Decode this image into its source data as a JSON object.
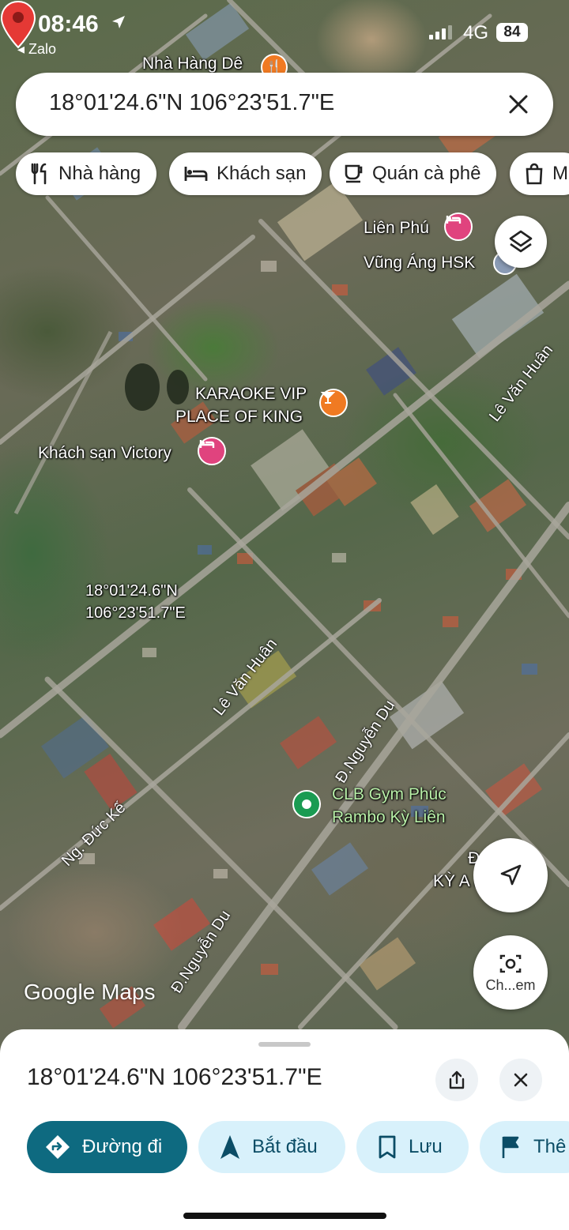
{
  "status_bar": {
    "time": "08:46",
    "back_app": "◂ Zalo",
    "network": "4G",
    "battery": "84"
  },
  "search": {
    "query": "18°01'24.6\"N 106°23'51.7\"E"
  },
  "chips": [
    {
      "label": "Nhà hàng",
      "icon": "restaurant-icon"
    },
    {
      "label": "Khách sạn",
      "icon": "hotel-icon"
    },
    {
      "label": "Quán cà phê",
      "icon": "coffee-icon"
    },
    {
      "label": "M",
      "icon": "shopping-bag-icon"
    }
  ],
  "map": {
    "labels": {
      "nha_hang_de": "Nhà Hàng Dê",
      "lien_phu": "Liên Phú",
      "vung_ang": "Vũng Áng HSK",
      "karaoke_1": "KARAOKE VIP",
      "karaoke_2": "PLACE OF KING",
      "khach_san_victory": "Khách sạn Victory",
      "pin_lat": "18°01'24.6\"N",
      "pin_lng": "106°23'51.7\"E",
      "gym_1": "CLB Gym Phúc",
      "gym_2": "Rambo Kỳ Liên",
      "partial_1": "Đ        H B",
      "partial_2": "KỲ A        H V"
    },
    "roads": {
      "le_van_huan_top": "Lê Văn Huân",
      "le_van_huan_mid": "Lê Văn Huân",
      "nguyen_du_mid": "Đ.Nguyễn Du",
      "nguyen_du_bottom": "Đ.Nguyễn Du",
      "duc_ke": "Ng. Đức Kế"
    },
    "google_logo": "Google Maps"
  },
  "camera_caption": "Ch...em",
  "sheet": {
    "title": "18°01'24.6\"N 106°23'51.7\"E",
    "actions": [
      {
        "label": "Đường đi",
        "icon": "directions-icon"
      },
      {
        "label": "Bắt đầu",
        "icon": "navigation-arrow-icon"
      },
      {
        "label": "Lưu",
        "icon": "bookmark-icon"
      },
      {
        "label": "Thê",
        "icon": "flag-icon"
      }
    ]
  },
  "colors": {
    "primary": "#0e6a80",
    "tonal": "#d8f1fb",
    "pin_red": "#e53935"
  }
}
